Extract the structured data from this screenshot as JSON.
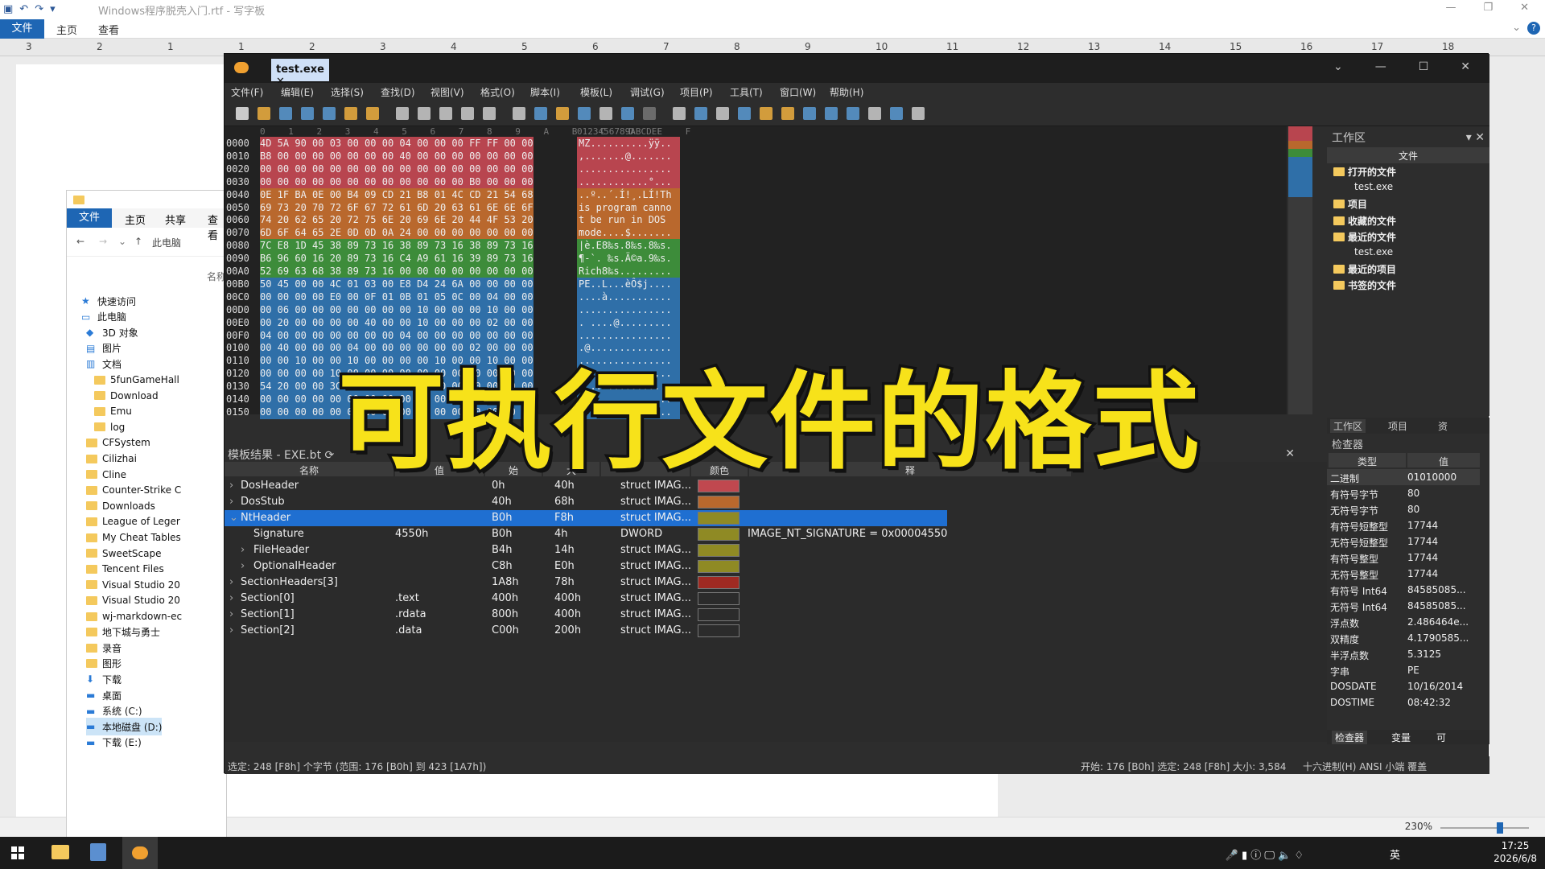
{
  "wordpad": {
    "title": "Windows程序脱壳入门.rtf - 写字板",
    "menu": [
      "文件",
      "主页",
      "查看"
    ],
    "ruler": [
      "3",
      "2",
      "1",
      "1",
      "2",
      "3",
      "4",
      "5",
      "6",
      "7",
      "8",
      "9",
      "10",
      "11",
      "12",
      "13",
      "14",
      "15",
      "16",
      "17",
      "18"
    ],
    "zoom": "230%"
  },
  "explorer": {
    "tabs": [
      "文件",
      "主页",
      "共享",
      "查看"
    ],
    "address": "此电脑",
    "name_header": "名称",
    "tree": [
      {
        "label": "快速访问",
        "kind": "star",
        "indent": 1
      },
      {
        "label": "此电脑",
        "kind": "pc",
        "indent": 1
      },
      {
        "label": "3D 对象",
        "kind": "3d",
        "indent": 2
      },
      {
        "label": "图片",
        "kind": "pic",
        "indent": 2
      },
      {
        "label": "文档",
        "kind": "doc",
        "indent": 2
      },
      {
        "label": "5funGameHall",
        "kind": "folder",
        "indent": 3
      },
      {
        "label": "Download",
        "kind": "folder",
        "indent": 3
      },
      {
        "label": "Emu",
        "kind": "folder",
        "indent": 3
      },
      {
        "label": "log",
        "kind": "folder",
        "indent": 3
      },
      {
        "label": "CFSystem",
        "kind": "folder",
        "indent": 2
      },
      {
        "label": "Cilizhai",
        "kind": "folder",
        "indent": 2
      },
      {
        "label": "Cline",
        "kind": "folder",
        "indent": 2
      },
      {
        "label": "Counter-Strike C",
        "kind": "folder",
        "indent": 2
      },
      {
        "label": "Downloads",
        "kind": "folder",
        "indent": 2
      },
      {
        "label": "League of Leger",
        "kind": "folder",
        "indent": 2
      },
      {
        "label": "My Cheat Tables",
        "kind": "folder",
        "indent": 2
      },
      {
        "label": "SweetScape",
        "kind": "folder",
        "indent": 2
      },
      {
        "label": "Tencent Files",
        "kind": "folder",
        "indent": 2
      },
      {
        "label": "Visual Studio 20",
        "kind": "folder",
        "indent": 2
      },
      {
        "label": "Visual Studio 20",
        "kind": "folder",
        "indent": 2
      },
      {
        "label": "wj-markdown-ec",
        "kind": "folder",
        "indent": 2
      },
      {
        "label": "地下城与勇士",
        "kind": "folder",
        "indent": 2
      },
      {
        "label": "录音",
        "kind": "folder",
        "indent": 2
      },
      {
        "label": "图形",
        "kind": "folder",
        "indent": 2
      },
      {
        "label": "下载",
        "kind": "dl",
        "indent": 2
      },
      {
        "label": "桌面",
        "kind": "desk",
        "indent": 2
      },
      {
        "label": "系统 (C:)",
        "kind": "drive",
        "indent": 2
      },
      {
        "label": "本地磁盘 (D:)",
        "kind": "drive",
        "indent": 2
      },
      {
        "label": "下载 (E:)",
        "kind": "drive",
        "indent": 2
      }
    ]
  },
  "editor": {
    "tab": "test.exe",
    "menu": [
      "文件(F)",
      "编辑(E)",
      "选择(S)",
      "查找(D)",
      "视图(V)",
      "格式(O)",
      "脚本(I)",
      "模板(L)",
      "调试(G)",
      "项目(P)",
      "工具(T)",
      "窗口(W)",
      "帮助(H)"
    ],
    "hex_col_header": "0 1 2 3 4 5 6 7 8 9 A B C D E F",
    "ascii_col_header": "0123456789ABCDEF",
    "hex_rows": [
      {
        "off": "0000",
        "hex": "4D 5A 90 00 03 00 00 00 04 00 00 00 FF FF 00 00",
        "ascii": "MZ..........ÿÿ..",
        "color": "#b8454f"
      },
      {
        "off": "0010",
        "hex": "B8 00 00 00 00 00 00 00 40 00 00 00 00 00 00 00",
        "ascii": ",.......@.......",
        "color": "#b8454f"
      },
      {
        "off": "0020",
        "hex": "00 00 00 00 00 00 00 00 00 00 00 00 00 00 00 00",
        "ascii": "................",
        "color": "#b8454f"
      },
      {
        "off": "0030",
        "hex": "00 00 00 00 00 00 00 00 00 00 00 00 B0 00 00 00",
        "ascii": "............°...",
        "color": "#b8454f"
      },
      {
        "off": "0040",
        "hex": "0E 1F BA 0E 00 B4 09 CD 21 B8 01 4C CD 21 54 68",
        "ascii": "..º..´.Í!¸.LÍ!Th",
        "color": "#b9682d"
      },
      {
        "off": "0050",
        "hex": "69 73 20 70 72 6F 67 72 61 6D 20 63 61 6E 6E 6F",
        "ascii": "is program canno",
        "color": "#b9682d"
      },
      {
        "off": "0060",
        "hex": "74 20 62 65 20 72 75 6E 20 69 6E 20 44 4F 53 20",
        "ascii": "t be run in DOS ",
        "color": "#b9682d"
      },
      {
        "off": "0070",
        "hex": "6D 6F 64 65 2E 0D 0D 0A 24 00 00 00 00 00 00 00",
        "ascii": "mode....$.......",
        "color": "#b9682d"
      },
      {
        "off": "0080",
        "hex": "7C E8 1D 45 38 89 73 16 38 89 73 16 38 89 73 16",
        "ascii": "|è.E8‰s.8‰s.8‰s.",
        "color": "#3d8c3a"
      },
      {
        "off": "0090",
        "hex": "B6 96 60 16 20 89 73 16 C4 A9 61 16 39 89 73 16",
        "ascii": "¶-`. ‰s.Ä©a.9‰s.",
        "color": "#3d8c3a"
      },
      {
        "off": "00A0",
        "hex": "52 69 63 68 38 89 73 16 00 00 00 00 00 00 00 00",
        "ascii": "Rich8‰s.........",
        "color": "#3d8c3a"
      },
      {
        "off": "00B0",
        "hex": "50 45 00 00 4C 01 03 00 E8 D4 24 6A 00 00 00 00",
        "ascii": "PE..L...èÔ$j....",
        "color": "#2f6fa8"
      },
      {
        "off": "00C0",
        "hex": "00 00 00 00 E0 00 0F 01 0B 01 05 0C 00 04 00 00",
        "ascii": "....à...........",
        "color": "#2f6fa8"
      },
      {
        "off": "00D0",
        "hex": "00 06 00 00 00 00 00 00 00 10 00 00 00 10 00 00",
        "ascii": "................",
        "color": "#2f6fa8"
      },
      {
        "off": "00E0",
        "hex": "00 20 00 00 00 00 40 00 00 10 00 00 00 02 00 00",
        "ascii": ". ....@.........",
        "color": "#2f6fa8"
      },
      {
        "off": "00F0",
        "hex": "04 00 00 00 00 00 00 00 04 00 00 00 00 00 00 00",
        "ascii": "................",
        "color": "#2f6fa8"
      },
      {
        "off": "0100",
        "hex": "00 40 00 00 00 04 00 00 00 00 00 00 02 00 00 00",
        "ascii": ".@..............",
        "color": "#2f6fa8"
      },
      {
        "off": "0110",
        "hex": "00 00 10 00 00 10 00 00 00 00 10 00 00 10 00 00",
        "ascii": "................",
        "color": "#2f6fa8"
      },
      {
        "off": "0120",
        "hex": "00 00 00 00 10 00 00 00 00 00 00 00 00 00 00 00",
        "ascii": "................",
        "color": "#2f6fa8"
      },
      {
        "off": "0130",
        "hex": "54 20 00 00 3C 00 00 00 00 00 00 00 00 00 00 00",
        "ascii": "T ..<...........",
        "color": "#2f6fa8"
      },
      {
        "off": "0140",
        "hex": "00 00 00 00 00 00 00 00 00 00 00 00 00 00 00 00",
        "ascii": "................",
        "color": "#2f6fa8"
      },
      {
        "off": "0150",
        "hex": "00 00 00 00 00 00 00 00 00 00 00 00 00 00 00 00",
        "ascii": "................",
        "color": "#2f6fa8"
      }
    ],
    "workspace": {
      "title": "工作区",
      "file_header": "文件",
      "items": [
        {
          "label": "打开的文件",
          "bold": true
        },
        {
          "label": "test.exe",
          "bold": false
        },
        {
          "label": "项目",
          "bold": true
        },
        {
          "label": "收藏的文件",
          "bold": true
        },
        {
          "label": "最近的文件",
          "bold": true
        },
        {
          "label": "test.exe",
          "bold": false
        },
        {
          "label": "最近的项目",
          "bold": true
        },
        {
          "label": "书签的文件",
          "bold": true
        }
      ],
      "tabs": [
        "工作区",
        "项目",
        "资"
      ]
    },
    "template": {
      "title": "模板结果 - EXE.bt",
      "columns": [
        "名称",
        "值",
        "始",
        "大",
        "颜色",
        "释"
      ],
      "rows": [
        {
          "name": "DosHeader",
          "value": "",
          "start": "0h",
          "size": "40h",
          "type": "struct IMAG...",
          "color": "#c0484f",
          "comment": "",
          "sel": false,
          "ind": 0
        },
        {
          "name": "DosStub",
          "value": "",
          "start": "40h",
          "size": "68h",
          "type": "struct IMAG...",
          "color": "#b9682d",
          "comment": "",
          "sel": false,
          "ind": 0
        },
        {
          "name": "NtHeader",
          "value": "",
          "start": "B0h",
          "size": "F8h",
          "type": "struct IMAG...",
          "color": "#8f8a24",
          "comment": "",
          "sel": true,
          "ind": 0
        },
        {
          "name": "Signature",
          "value": "4550h",
          "start": "B0h",
          "size": "4h",
          "type": "DWORD",
          "color": "#8f8a24",
          "comment": "IMAGE_NT_SIGNATURE = 0x00004550",
          "sel": false,
          "ind": 1
        },
        {
          "name": "FileHeader",
          "value": "",
          "start": "B4h",
          "size": "14h",
          "type": "struct IMAG...",
          "color": "#8f8a24",
          "comment": "",
          "sel": false,
          "ind": 1
        },
        {
          "name": "OptionalHeader",
          "value": "",
          "start": "C8h",
          "size": "E0h",
          "type": "struct IMAG...",
          "color": "#8f8a24",
          "comment": "",
          "sel": false,
          "ind": 1
        },
        {
          "name": "SectionHeaders[3]",
          "value": "",
          "start": "1A8h",
          "size": "78h",
          "type": "struct IMAG...",
          "color": "#a02a22",
          "comment": "",
          "sel": false,
          "ind": 0
        },
        {
          "name": "Section[0]",
          "value": ".text",
          "start": "400h",
          "size": "400h",
          "type": "struct IMAG...",
          "color": "#2b2b2b",
          "comment": "",
          "sel": false,
          "ind": 0
        },
        {
          "name": "Section[1]",
          "value": ".rdata",
          "start": "800h",
          "size": "400h",
          "type": "struct IMAG...",
          "color": "#2b2b2b",
          "comment": "",
          "sel": false,
          "ind": 0
        },
        {
          "name": "Section[2]",
          "value": ".data",
          "start": "C00h",
          "size": "200h",
          "type": "struct IMAG...",
          "color": "#2b2b2b",
          "comment": "",
          "sel": false,
          "ind": 0
        }
      ]
    },
    "inspector": {
      "title": "检查器",
      "col_type": "类型",
      "col_value": "值",
      "rows": [
        {
          "k": "二进制",
          "v": "01010000"
        },
        {
          "k": "有符号字节",
          "v": "80"
        },
        {
          "k": "无符号字节",
          "v": "80"
        },
        {
          "k": "有符号短整型",
          "v": "17744"
        },
        {
          "k": "无符号短整型",
          "v": "17744"
        },
        {
          "k": "有符号整型",
          "v": "17744"
        },
        {
          "k": "无符号整型",
          "v": "17744"
        },
        {
          "k": "有符号 Int64",
          "v": "84585085..."
        },
        {
          "k": "无符号 Int64",
          "v": "84585085..."
        },
        {
          "k": "浮点数",
          "v": "2.486464e..."
        },
        {
          "k": "双精度",
          "v": "4.1790585..."
        },
        {
          "k": "半浮点数",
          "v": "5.3125"
        },
        {
          "k": "字串",
          "v": "PE"
        },
        {
          "k": "DOSDATE",
          "v": "10/16/2014"
        },
        {
          "k": "DOSTIME",
          "v": "08:42:32"
        }
      ],
      "tabs": [
        "检查器",
        "变量",
        "可"
      ]
    },
    "status_left": "选定: 248 [F8h] 个字节 (范围: 176 [B0h] 到 423 [1A7h])",
    "status_mid": "开始: 176 [B0h]  选定: 248 [F8h]  大小: 3,584",
    "status_right": "十六进制(H)  ANSI  小端   覆盖"
  },
  "overlay_title": "可执行文件的格式",
  "taskbar": {
    "time": "17:25",
    "date": "2026/6/8",
    "ime": "英"
  }
}
